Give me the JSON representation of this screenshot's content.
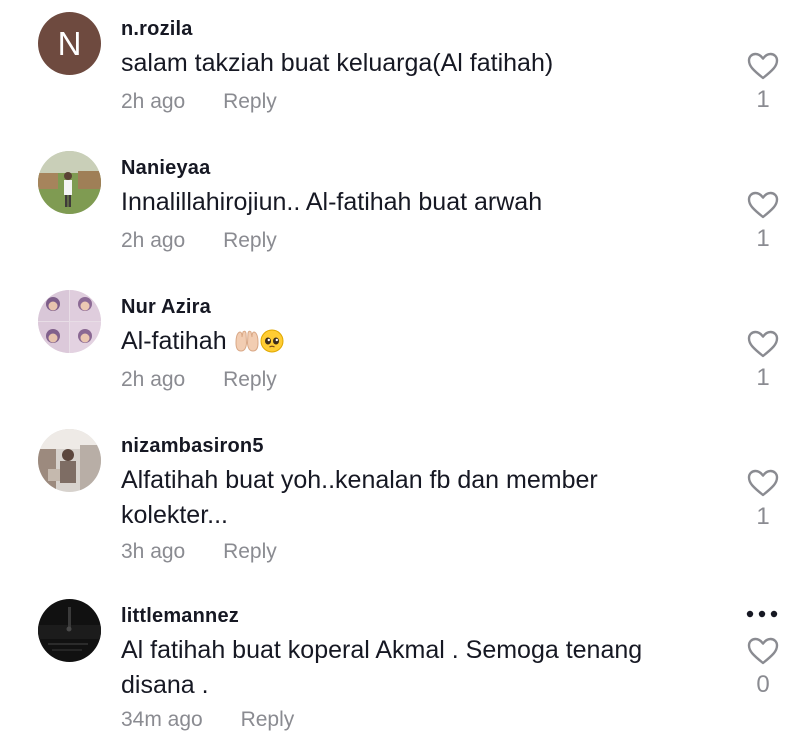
{
  "comments": [
    {
      "username": "n.rozila",
      "avatar_letter": "N",
      "text": "salam takziah buat keluarga(Al fatihah)",
      "time": "2h ago",
      "reply": "Reply",
      "likes": "1"
    },
    {
      "username": "Nanieyaa",
      "text": "Innalillahirojiun.. Al-fatihah buat arwah",
      "time": "2h ago",
      "reply": "Reply",
      "likes": "1"
    },
    {
      "username": "Nur Azira",
      "text": "Al-fatihah ",
      "emoji": [
        "palms-up-together-emoji",
        "pleading-face-emoji"
      ],
      "time": "2h ago",
      "reply": "Reply",
      "likes": "1"
    },
    {
      "username": "nizambasiron5",
      "text": "Alfatihah buat yoh..kenalan fb dan member kolekter...",
      "time": "3h ago",
      "reply": "Reply",
      "likes": "1"
    },
    {
      "username": "littlemannez",
      "text": "Al fatihah buat koperal Akmal . Semoga tenang disana .",
      "time": "34m ago",
      "reply": "Reply",
      "likes": "0"
    }
  ],
  "colors": {
    "text_primary": "#161823",
    "text_secondary": "#8a8b91",
    "avatar_letter_bg": "#6e4a3f"
  },
  "icons": {
    "like": "heart-outline-icon",
    "more": "more-horizontal-icon"
  }
}
